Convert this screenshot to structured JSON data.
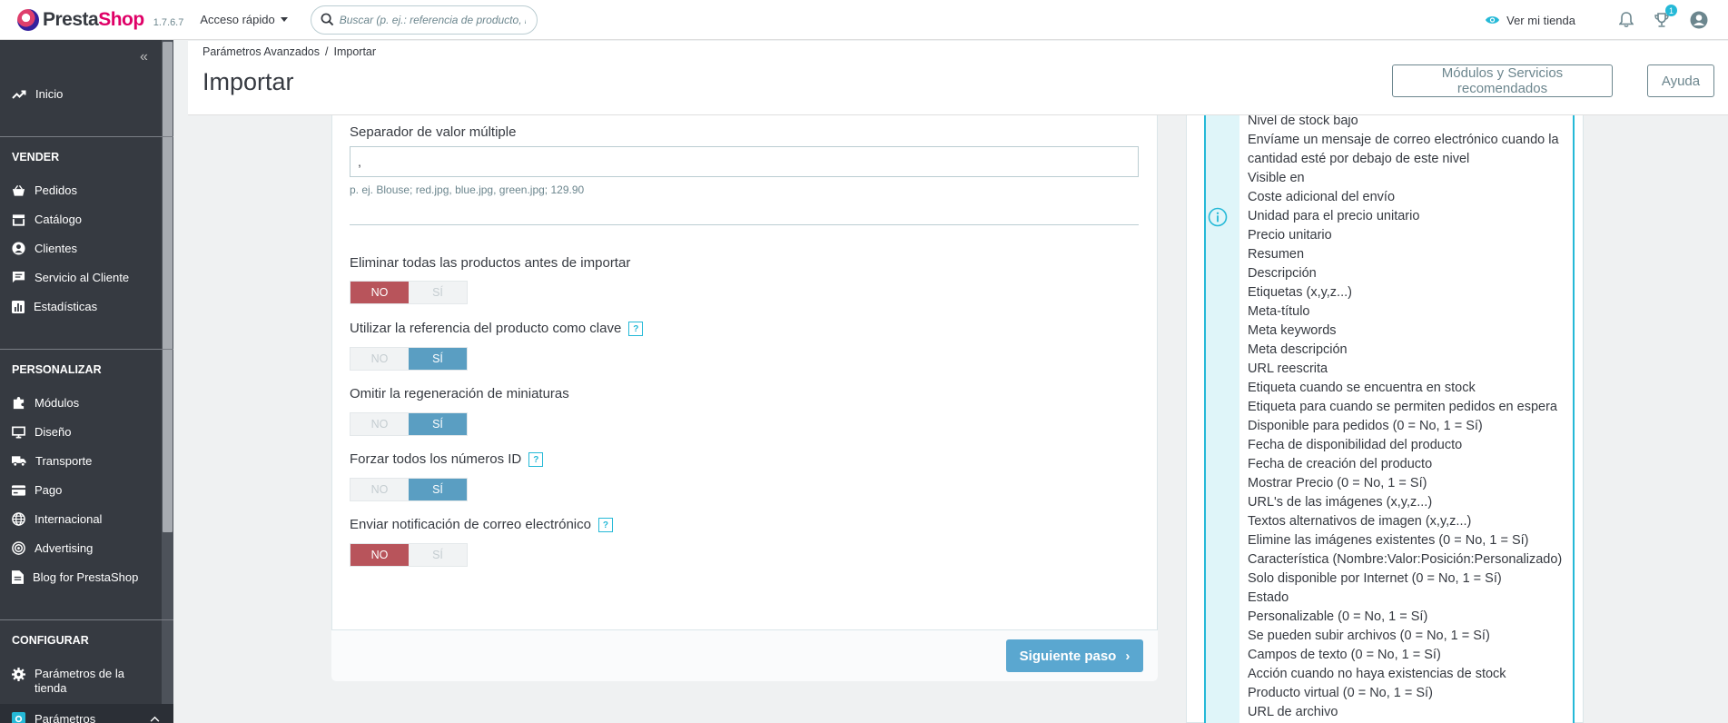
{
  "topbar": {
    "logo_presta": "Presta",
    "logo_shop": "Shop",
    "version": "1.7.6.7",
    "quick_access": "Acceso rápido",
    "search_placeholder": "Buscar (p. ej.: referencia de producto, no",
    "view_shop": "Ver mi tienda",
    "orders_badge": "1"
  },
  "sidebar": {
    "collapse_label": "«",
    "home": "Inicio",
    "sell_section": "VENDER",
    "sell_items": [
      "Pedidos",
      "Catálogo",
      "Clientes",
      "Servicio al Cliente",
      "Estadísticas"
    ],
    "customize_section": "PERSONALIZAR",
    "customize_items": [
      "Módulos",
      "Diseño",
      "Transporte",
      "Pago",
      "Internacional",
      "Advertising",
      "Blog for PrestaShop"
    ],
    "configure_section": "CONFIGURAR",
    "configure_items": [
      "Parámetros de la tienda",
      "Parámetros"
    ]
  },
  "header": {
    "breadcrumb": [
      "Parámetros Avanzados",
      "Importar"
    ],
    "title": "Importar",
    "modules_button": "Módulos y Servicios recomendados",
    "help_button": "Ayuda"
  },
  "form": {
    "multi_sep_label": "Separador de valor múltiple",
    "multi_sep_value": ",",
    "multi_sep_hint": "p. ej. Blouse; red.jpg, blue.jpg, green.jpg; 129.90",
    "no_label": "NO",
    "yes_label": "SÍ",
    "toggles": [
      {
        "label": "Eliminar todas las productos antes de importar",
        "value": "NO",
        "help": false
      },
      {
        "label": "Utilizar la referencia del producto como clave",
        "value": "SÍ",
        "help": true
      },
      {
        "label": "Omitir la regeneración de miniaturas",
        "value": "SÍ",
        "help": false
      },
      {
        "label": "Forzar todos los números ID",
        "value": "SÍ",
        "help": true
      },
      {
        "label": "Enviar notificación de correo electrónico",
        "value": "NO",
        "help": true
      }
    ],
    "help_glyph": "?",
    "next_button": "Siguiente paso"
  },
  "info_panel": {
    "fields": [
      "Nivel de stock bajo",
      "Envíame un mensaje de correo electrónico cuando la cantidad esté por debajo de este nivel",
      "Visible en",
      "Coste adicional del envío",
      "Unidad para el precio unitario",
      "Precio unitario",
      "Resumen",
      "Descripción",
      "Etiquetas (x,y,z...)",
      "Meta-título",
      "Meta keywords",
      "Meta descripción",
      "URL reescrita",
      "Etiqueta cuando se encuentra en stock",
      "Etiqueta para cuando se permiten pedidos en espera",
      "Disponible para pedidos (0 = No, 1 = Sí)",
      "Fecha de disponibilidad del producto",
      "Fecha de creación del producto",
      "Mostrar Precio (0 = No, 1 = Sí)",
      "URL's de las imágenes (x,y,z...)",
      "Textos alternativos de imagen (x,y,z...)",
      "Elimine las imágenes existentes (0 = No, 1 = Sí)",
      "Característica (Nombre:Valor:Posición:Personalizado)",
      "Solo disponible por Internet (0 = No, 1 = Sí)",
      "Estado",
      "Personalizable (0 = No, 1 = Sí)",
      "Se pueden subir archivos (0 = No, 1 = Sí)",
      "Campos de texto (0 = No, 1 = Sí)",
      "Acción cuando no haya existencias de stock",
      "Producto virtual (0 = No, 1 = Sí)",
      "URL de archivo"
    ]
  },
  "colors": {
    "sidebar_bg": "#363a41",
    "accent": "#25b9d7",
    "no_active": "#b8545b",
    "yes_active": "#5a9ec2",
    "brand": "#df0067"
  }
}
